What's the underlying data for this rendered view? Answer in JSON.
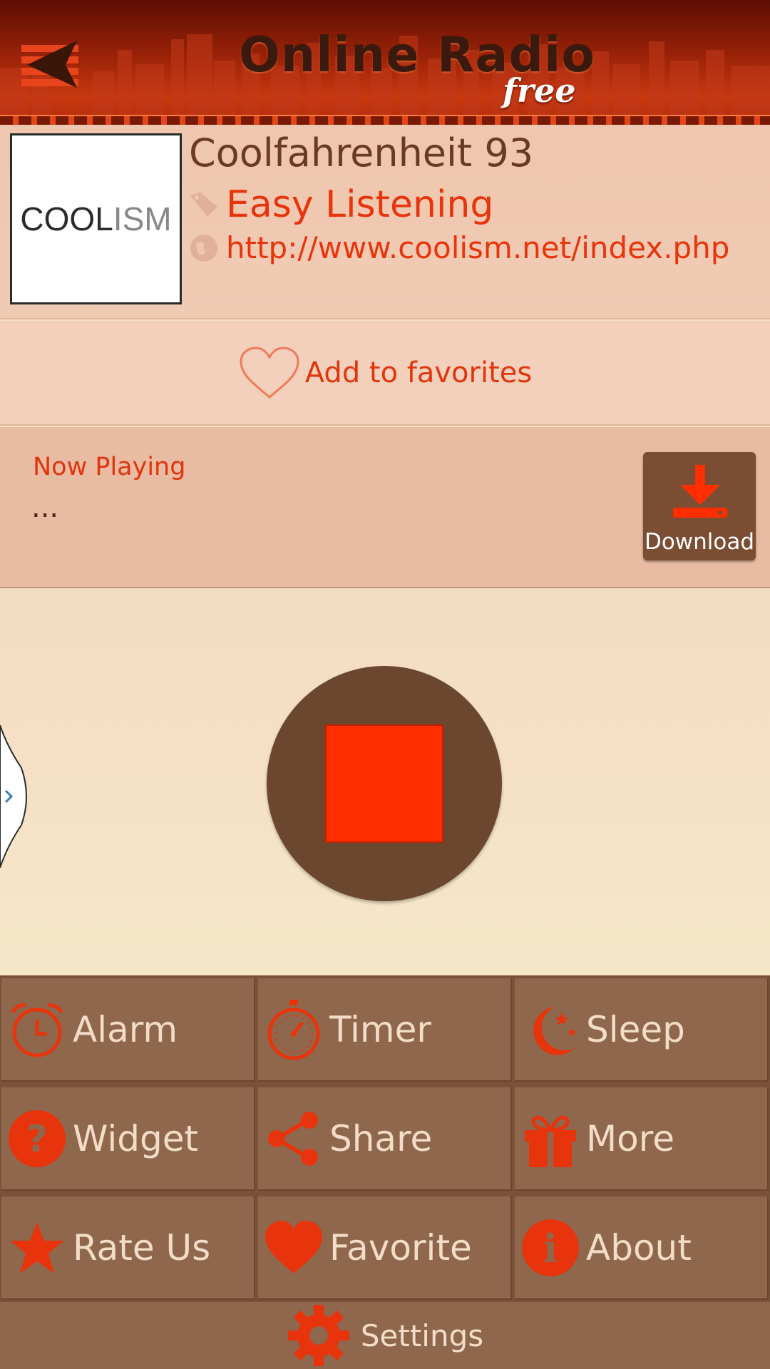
{
  "header": {
    "title": "Online Radio",
    "subtitle": "free"
  },
  "station": {
    "logo_text_dark": "COOL",
    "logo_text_light": "ISM",
    "name": "Coolfahrenheit 93",
    "genre": "Easy Listening",
    "url": "http://www.coolism.net/index.php"
  },
  "favorites": {
    "label": "Add to favorites"
  },
  "now_playing": {
    "title": "Now Playing",
    "text": "...",
    "download_label": "Download"
  },
  "menu": {
    "alarm": "Alarm",
    "timer": "Timer",
    "sleep": "Sleep",
    "widget": "Widget",
    "share": "Share",
    "more": "More",
    "rate": "Rate Us",
    "favorite": "Favorite",
    "about": "About",
    "settings": "Settings"
  },
  "colors": {
    "accent": "#e8340c",
    "stop": "#ff2e00",
    "tile": "#8e674d",
    "header": "#9a2208"
  }
}
